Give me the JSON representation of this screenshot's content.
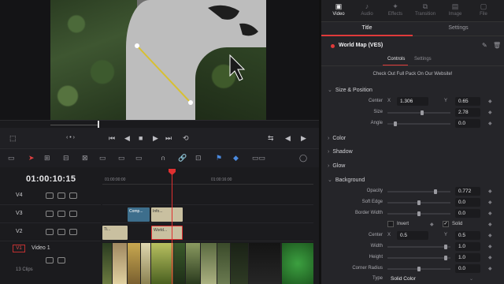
{
  "timeline": {
    "timecode": "01:00:10:15",
    "ruler": [
      "01:00:00:00",
      "01:00:16:00"
    ],
    "tracks": [
      {
        "id": "V4",
        "clips": []
      },
      {
        "id": "V3",
        "clips": [
          {
            "label": "Comp...",
            "color": "#3d6e8c"
          },
          {
            "label": "Info...",
            "color": "#c9c0a0"
          }
        ]
      },
      {
        "id": "V2",
        "clips": [
          {
            "label": "Ti...",
            "color": "#c9c0a0"
          },
          {
            "label": "World...",
            "color": "#c9c0a0"
          }
        ]
      }
    ],
    "v1": {
      "label": "V1",
      "name": "Video 1",
      "clip_count": "13 Clips"
    }
  },
  "inspector": {
    "tabs": [
      {
        "label": "Video",
        "icon": "video-icon",
        "active": true
      },
      {
        "label": "Audio",
        "icon": "audio-icon",
        "active": false
      },
      {
        "label": "Effects",
        "icon": "effects-icon",
        "active": false
      },
      {
        "label": "Transition",
        "icon": "transition-icon",
        "active": false
      },
      {
        "label": "Image",
        "icon": "image-icon",
        "active": false
      },
      {
        "label": "File",
        "icon": "file-icon",
        "active": false
      }
    ],
    "subtabs": {
      "title": "Title",
      "settings": "Settings"
    },
    "effect_name": "World Map (VES)",
    "control_tabs": {
      "controls": "Controls",
      "settings": "Settings"
    },
    "promo": "Check Out Full Pack On Our Website!",
    "sections": {
      "size_position": "Size & Position",
      "color": "Color",
      "shadow": "Shadow",
      "glow": "Glow",
      "background": "Background"
    },
    "params": {
      "center_label": "Center",
      "center_x": "1.306",
      "center_y": "0.65",
      "size_label": "Size",
      "size_val": "2.78",
      "angle_label": "Angle",
      "angle_val": "0.0",
      "opacity_label": "Opacity",
      "opacity_val": "0.772",
      "soft_edge_label": "Soft Edge",
      "soft_edge_val": "0.0",
      "border_width_label": "Border Width",
      "border_width_val": "0.0",
      "invert_label": "Invert",
      "solid_label": "Solid",
      "invert_checked": false,
      "solid_checked": true,
      "bg_center_label": "Center",
      "bg_center_x": "0.5",
      "bg_center_y": "0.5",
      "width_label": "Width",
      "width_val": "1.0",
      "height_label": "Height",
      "height_val": "1.0",
      "corner_radius_label": "Corner Radius",
      "corner_radius_val": "0.0",
      "type_label": "Type",
      "type_val": "Solid Color"
    },
    "slider_levels": {
      "size": 0.55,
      "angle": 0.1,
      "opacity": 0.77,
      "soft_edge": 0.5,
      "border_width": 0.5,
      "width": 0.95,
      "height": 0.95,
      "corner_radius": 0.5
    }
  }
}
